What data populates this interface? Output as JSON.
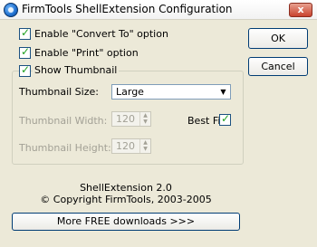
{
  "window": {
    "title": "FirmTools ShellExtension Configuration",
    "close_glyph": "x"
  },
  "options": {
    "convert_to": "Enable \"Convert To\" option",
    "print": "Enable \"Print\" option",
    "show_thumbnail": "Show Thumbnail",
    "convert_to_checked": true,
    "print_checked": true,
    "show_thumbnail_checked": true
  },
  "thumbnail": {
    "size_label": "Thumbnail Size:",
    "size_value": "Large",
    "width_label": "Thumbnail Width:",
    "width_value": "120",
    "height_label": "Thumbnail Height:",
    "height_value": "120",
    "best_fit_label": "Best Fit",
    "best_fit_checked": true
  },
  "buttons": {
    "ok": "OK",
    "cancel": "Cancel",
    "downloads": "More FREE downloads >>>"
  },
  "about": {
    "version": "ShellExtension 2.0",
    "copyright": "© Copyright FirmTools, 2003-2005"
  }
}
